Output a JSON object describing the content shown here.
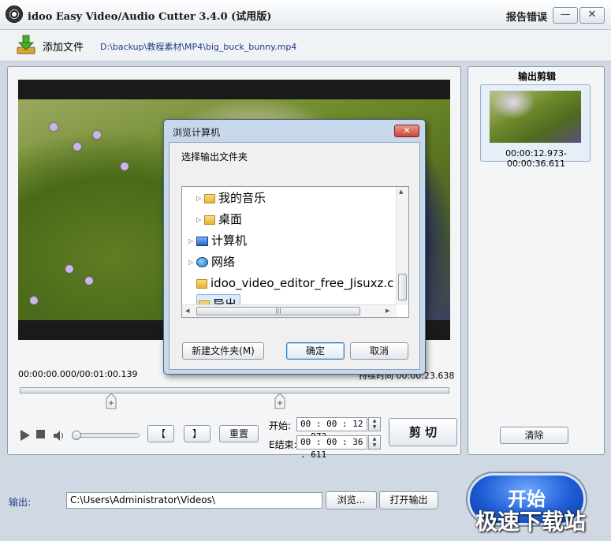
{
  "window": {
    "title": "idoo Easy Video/Audio Cutter 3.4.0 (试用版)",
    "report_label": "报告错误",
    "minimize_glyph": "—",
    "close_glyph": "✕"
  },
  "toolbar": {
    "add_file_label": "添加文件",
    "file_path": "D:\\backup\\教程素材\\MP4\\big_buck_bunny.mp4"
  },
  "player": {
    "time_position": "00:00:00.000/00:01:00.139",
    "time_duration": "持续时间 00:00:23.638",
    "mark_in_label": "【",
    "mark_out_label": "】",
    "reset_label": "重置",
    "start_label": "开始:",
    "end_label": "E结束:",
    "start_value": "00 : 00 : 12 . 973",
    "end_value": "00 : 00 : 36 . 611",
    "cut_label": "剪 切",
    "volume_fraction": 0.0
  },
  "clips": {
    "title": "输出剪辑",
    "items": [
      {
        "time_range": "00:00:12.973-00:00:36.611"
      }
    ],
    "clear_label": "清除"
  },
  "output": {
    "label": "输出:",
    "path": "C:\\Users\\Administrator\\Videos\\",
    "browse_label": "浏览...",
    "open_label": "打开输出",
    "start_label": "开始"
  },
  "watermark": "极速下载站",
  "dialog": {
    "title": "浏览计算机",
    "close_glyph": "✕",
    "prompt": "选择输出文件夹",
    "tree": [
      {
        "label": "我的音乐",
        "icon": "folder-icon",
        "arrow": "▷"
      },
      {
        "label": "桌面",
        "icon": "folder-icon",
        "arrow": "▷"
      },
      {
        "label": "计算机",
        "icon": "computer-icon",
        "arrow": "▷"
      },
      {
        "label": "网络",
        "icon": "network-icon",
        "arrow": "▷"
      },
      {
        "label": "idoo_video_editor_free_Jisuxz.c",
        "icon": "folder-icon",
        "arrow": ""
      },
      {
        "label": "导出",
        "icon": "folder-icon",
        "arrow": "",
        "selected": true
      }
    ],
    "new_folder_label": "新建文件夹(M)",
    "ok_label": "确定",
    "cancel_label": "取消"
  }
}
